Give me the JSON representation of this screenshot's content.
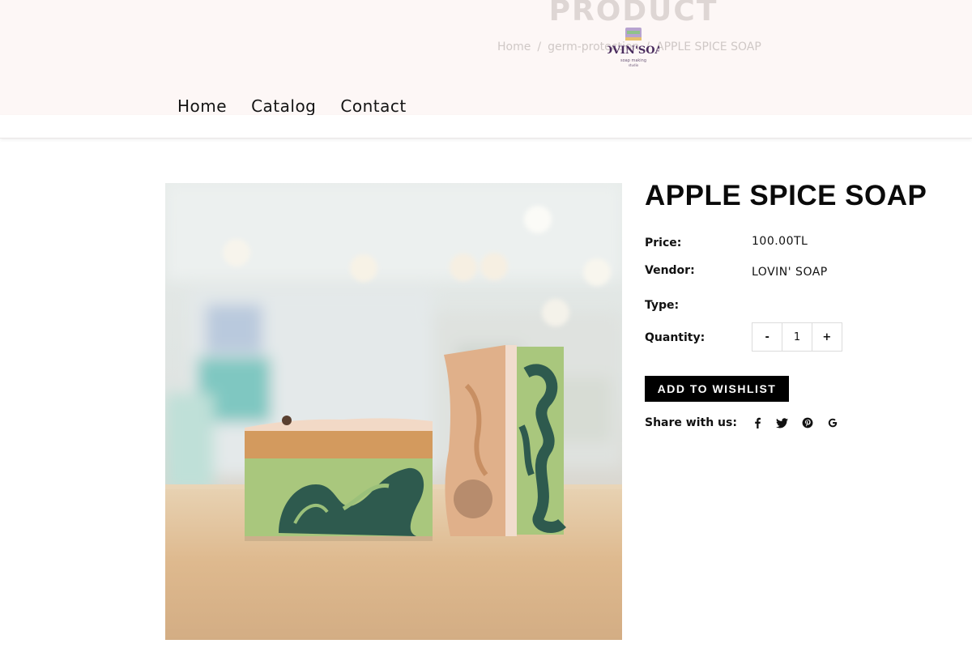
{
  "header": {
    "page_heading": "PRODUCT",
    "breadcrumb": {
      "home": "Home",
      "separator": "/",
      "collection": "germ-protection",
      "current": "APPLE SPICE SOAP"
    },
    "logo": {
      "text": "LOVIN' SOAP",
      "tagline": "soap making studio"
    },
    "nav": [
      {
        "label": "Home"
      },
      {
        "label": "Catalog"
      },
      {
        "label": "Contact"
      }
    ]
  },
  "product": {
    "title": "APPLE SPICE SOAP",
    "price_label": "Price:",
    "price_value": "100.00TL",
    "vendor_label": "Vendor:",
    "vendor_value": "LOVIN' SOAP",
    "type_label": "Type:",
    "type_value": "",
    "quantity_label": "Quantity:",
    "quantity": {
      "minus": "-",
      "value": "1",
      "plus": "+"
    },
    "wishlist_button": "ADD TO WISHLIST",
    "share_label": "Share with us:",
    "share_icons": [
      "facebook-icon",
      "twitter-icon",
      "pinterest-icon",
      "google-icon"
    ]
  },
  "colors": {
    "header_band": "#fdf7f6",
    "button_bg": "#000000",
    "soap_green": "#a9c77d",
    "soap_swirl": "#2e5a4e",
    "soap_orange": "#d39a5e"
  }
}
